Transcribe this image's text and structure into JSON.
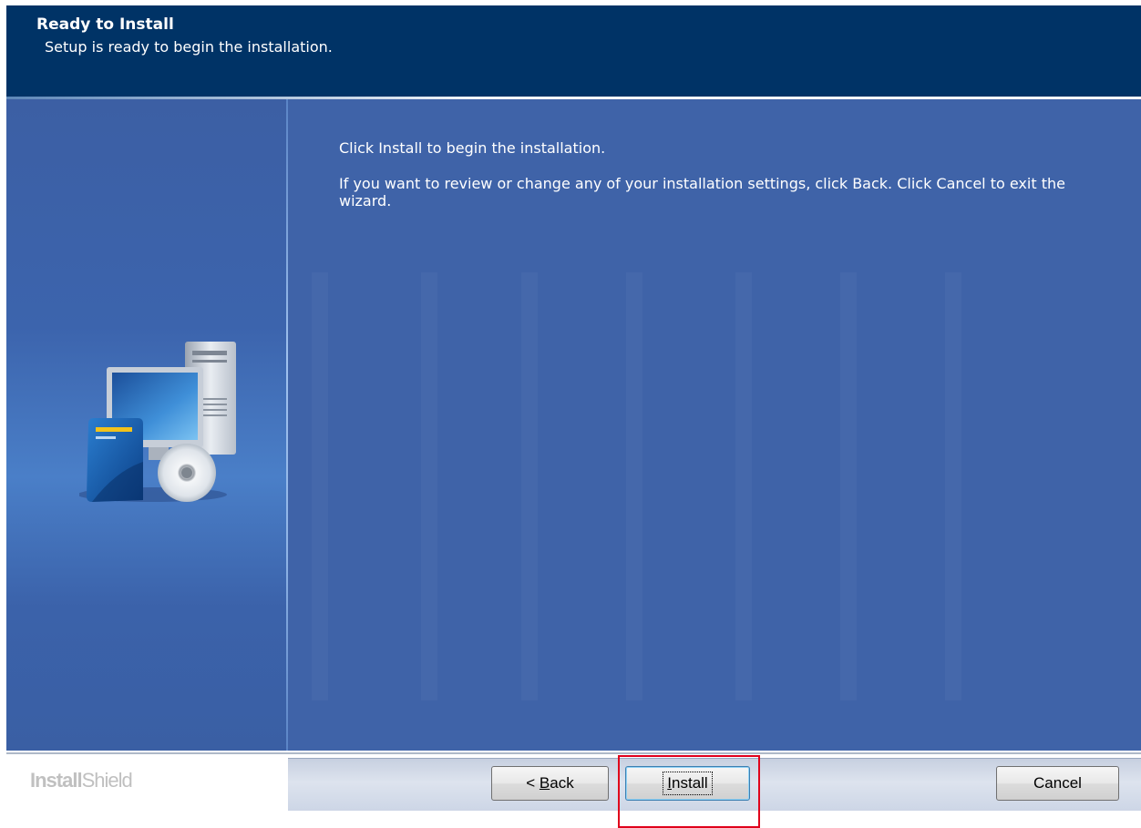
{
  "header": {
    "title": "Ready to Install",
    "subtitle": "Setup is ready to begin the installation."
  },
  "content": {
    "paragraph1": "Click Install to begin the installation.",
    "paragraph2": "If you want to review or change any of your installation settings, click Back. Click Cancel to exit the wizard."
  },
  "footer": {
    "brand_part1": "Install",
    "brand_part2": "Shield",
    "back_prefix": "< ",
    "back_accel": "B",
    "back_rest": "ack",
    "install_accel": "I",
    "install_rest": "nstall",
    "cancel_label": "Cancel"
  },
  "colors": {
    "header_bg": "#003366",
    "body_bg": "#3f63a8",
    "highlight": "#e0001b"
  },
  "icons": {
    "illustration": "computer-with-cd-icon"
  }
}
